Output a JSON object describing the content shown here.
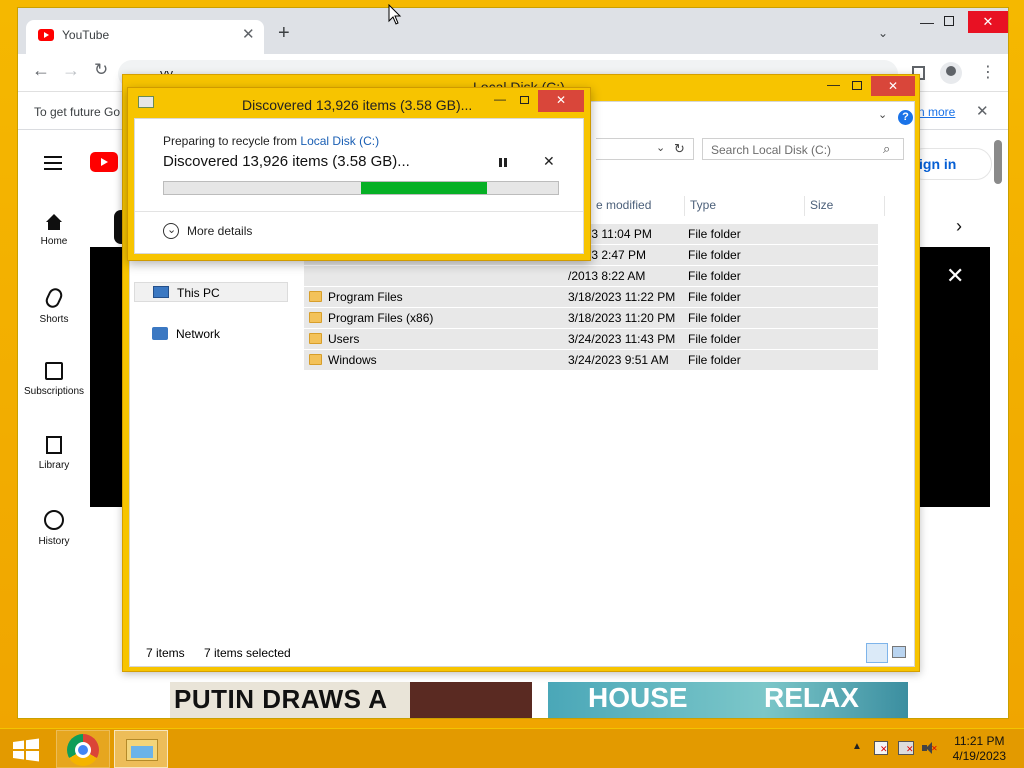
{
  "chrome": {
    "tab_title": "YouTube",
    "address_text": "yy",
    "infobar_text": "To get future Go",
    "infobar_link": "n more"
  },
  "youtube": {
    "sign_in": "ign in",
    "sidebar": [
      {
        "label": "Home",
        "icon": "home-icon"
      },
      {
        "label": "Shorts",
        "icon": "shorts-icon"
      },
      {
        "label": "Subscriptions",
        "icon": "subscriptions-icon"
      },
      {
        "label": "Library",
        "icon": "library-icon"
      },
      {
        "label": "History",
        "icon": "history-icon"
      }
    ],
    "thumb1_text": "PUTIN DRAWS A",
    "thumb2_text_a": "HOUSE",
    "thumb2_text_b": "RELAX"
  },
  "explorer": {
    "title": "Local Disk (C:)",
    "search_placeholder": "Search Local Disk (C:)",
    "columns": {
      "date": "e modified",
      "type": "Type",
      "size": "Size"
    },
    "nav": [
      {
        "label": "This PC",
        "icon": "this-pc-icon"
      },
      {
        "label": "Network",
        "icon": "network-icon"
      }
    ],
    "rows": [
      {
        "name": "",
        "date": "/2023 11:04 PM",
        "type": "File folder"
      },
      {
        "name": "",
        "date": "/2023 2:47 PM",
        "type": "File folder"
      },
      {
        "name": "",
        "date": "/2013 8:22 AM",
        "type": "File folder"
      },
      {
        "name": "Program Files",
        "date": "3/18/2023 11:22 PM",
        "type": "File folder"
      },
      {
        "name": "Program Files (x86)",
        "date": "3/18/2023 11:20 PM",
        "type": "File folder"
      },
      {
        "name": "Users",
        "date": "3/24/2023 11:43 PM",
        "type": "File folder"
      },
      {
        "name": "Windows",
        "date": "3/24/2023 9:51 AM",
        "type": "File folder"
      }
    ],
    "status_items": "7 items",
    "status_selected": "7 items selected"
  },
  "dialog": {
    "title": "Discovered 13,926 items (3.58 GB)...",
    "preparing_prefix": "Preparing to recycle from",
    "preparing_link": "Local Disk (C:)",
    "heading": "Discovered 13,926 items (3.58 GB)...",
    "more_details": "More details",
    "progress": {
      "start_fraction": 0.5,
      "end_fraction": 0.82
    }
  },
  "taskbar": {
    "time": "11:21 PM",
    "date": "4/19/2023"
  },
  "colors": {
    "desktop": "#f2a900",
    "progress_green": "#06b025",
    "youtube_red": "#ff0000",
    "link_blue": "#1a5fb4"
  }
}
